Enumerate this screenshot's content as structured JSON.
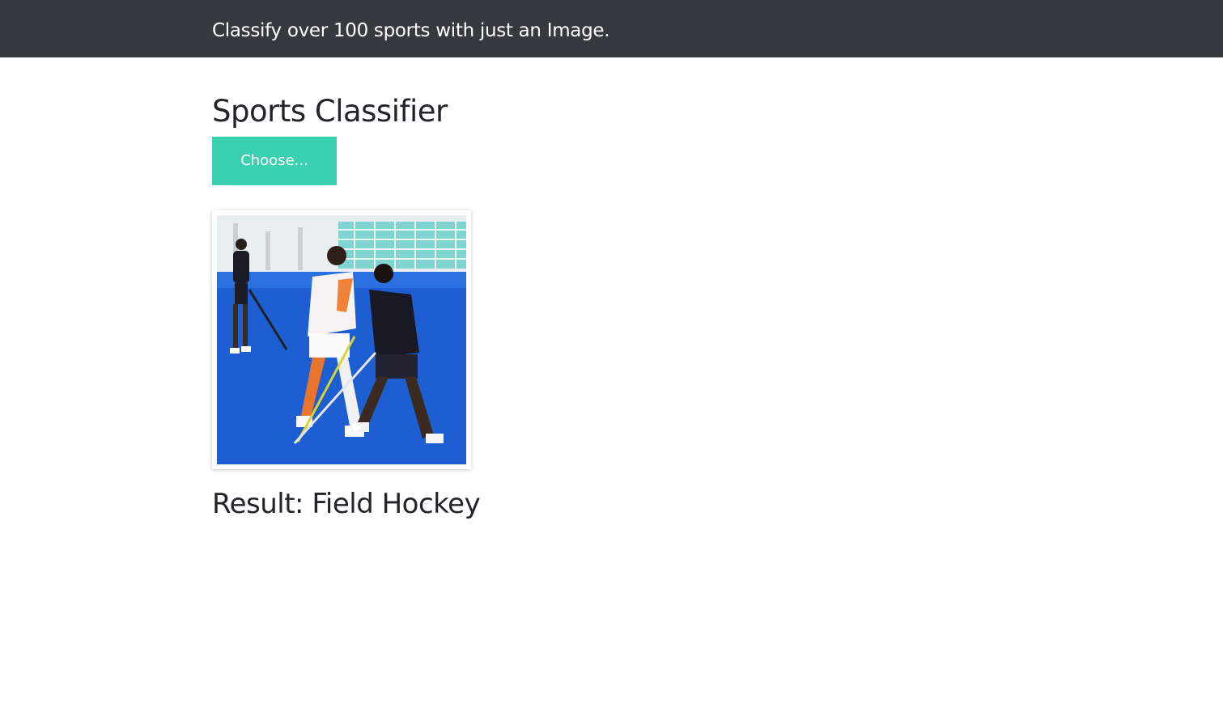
{
  "navbar": {
    "tagline": "Classify over 100 sports with just an Image."
  },
  "main": {
    "title": "Sports Classifier",
    "choose_button_label": "Choose...",
    "result_label": "Result:",
    "result_value": "Field Hockey"
  },
  "colors": {
    "navbar_bg": "#343a40",
    "button_bg": "#3ad1b0",
    "turf_blue": "#1d5fd3"
  }
}
